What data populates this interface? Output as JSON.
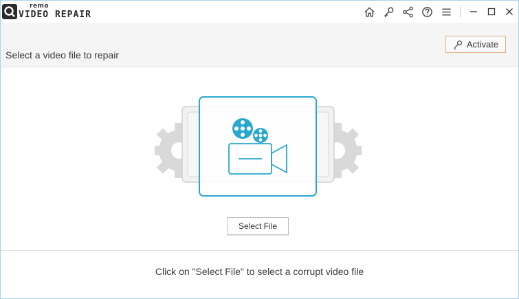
{
  "app": {
    "brand_prefix": "remo",
    "product_name": "VIDEO REPAIR"
  },
  "toolbar": {
    "icons": [
      "home-icon",
      "key-icon",
      "share-icon",
      "help-icon",
      "menu-icon"
    ],
    "window_controls": [
      "minimize-icon",
      "maximize-icon",
      "close-icon"
    ]
  },
  "header": {
    "title": "Select a video file to repair",
    "activate_label": "Activate"
  },
  "main": {
    "select_file_label": "Select File",
    "hint": "Click on \"Select File\" to select a corrupt video file"
  },
  "colors": {
    "accent": "#2aa7cf",
    "activate_border": "#e0b07a",
    "window_border": "#a8d4e6",
    "gear_gray": "#d6d6d6",
    "icon_dark": "#444444"
  }
}
